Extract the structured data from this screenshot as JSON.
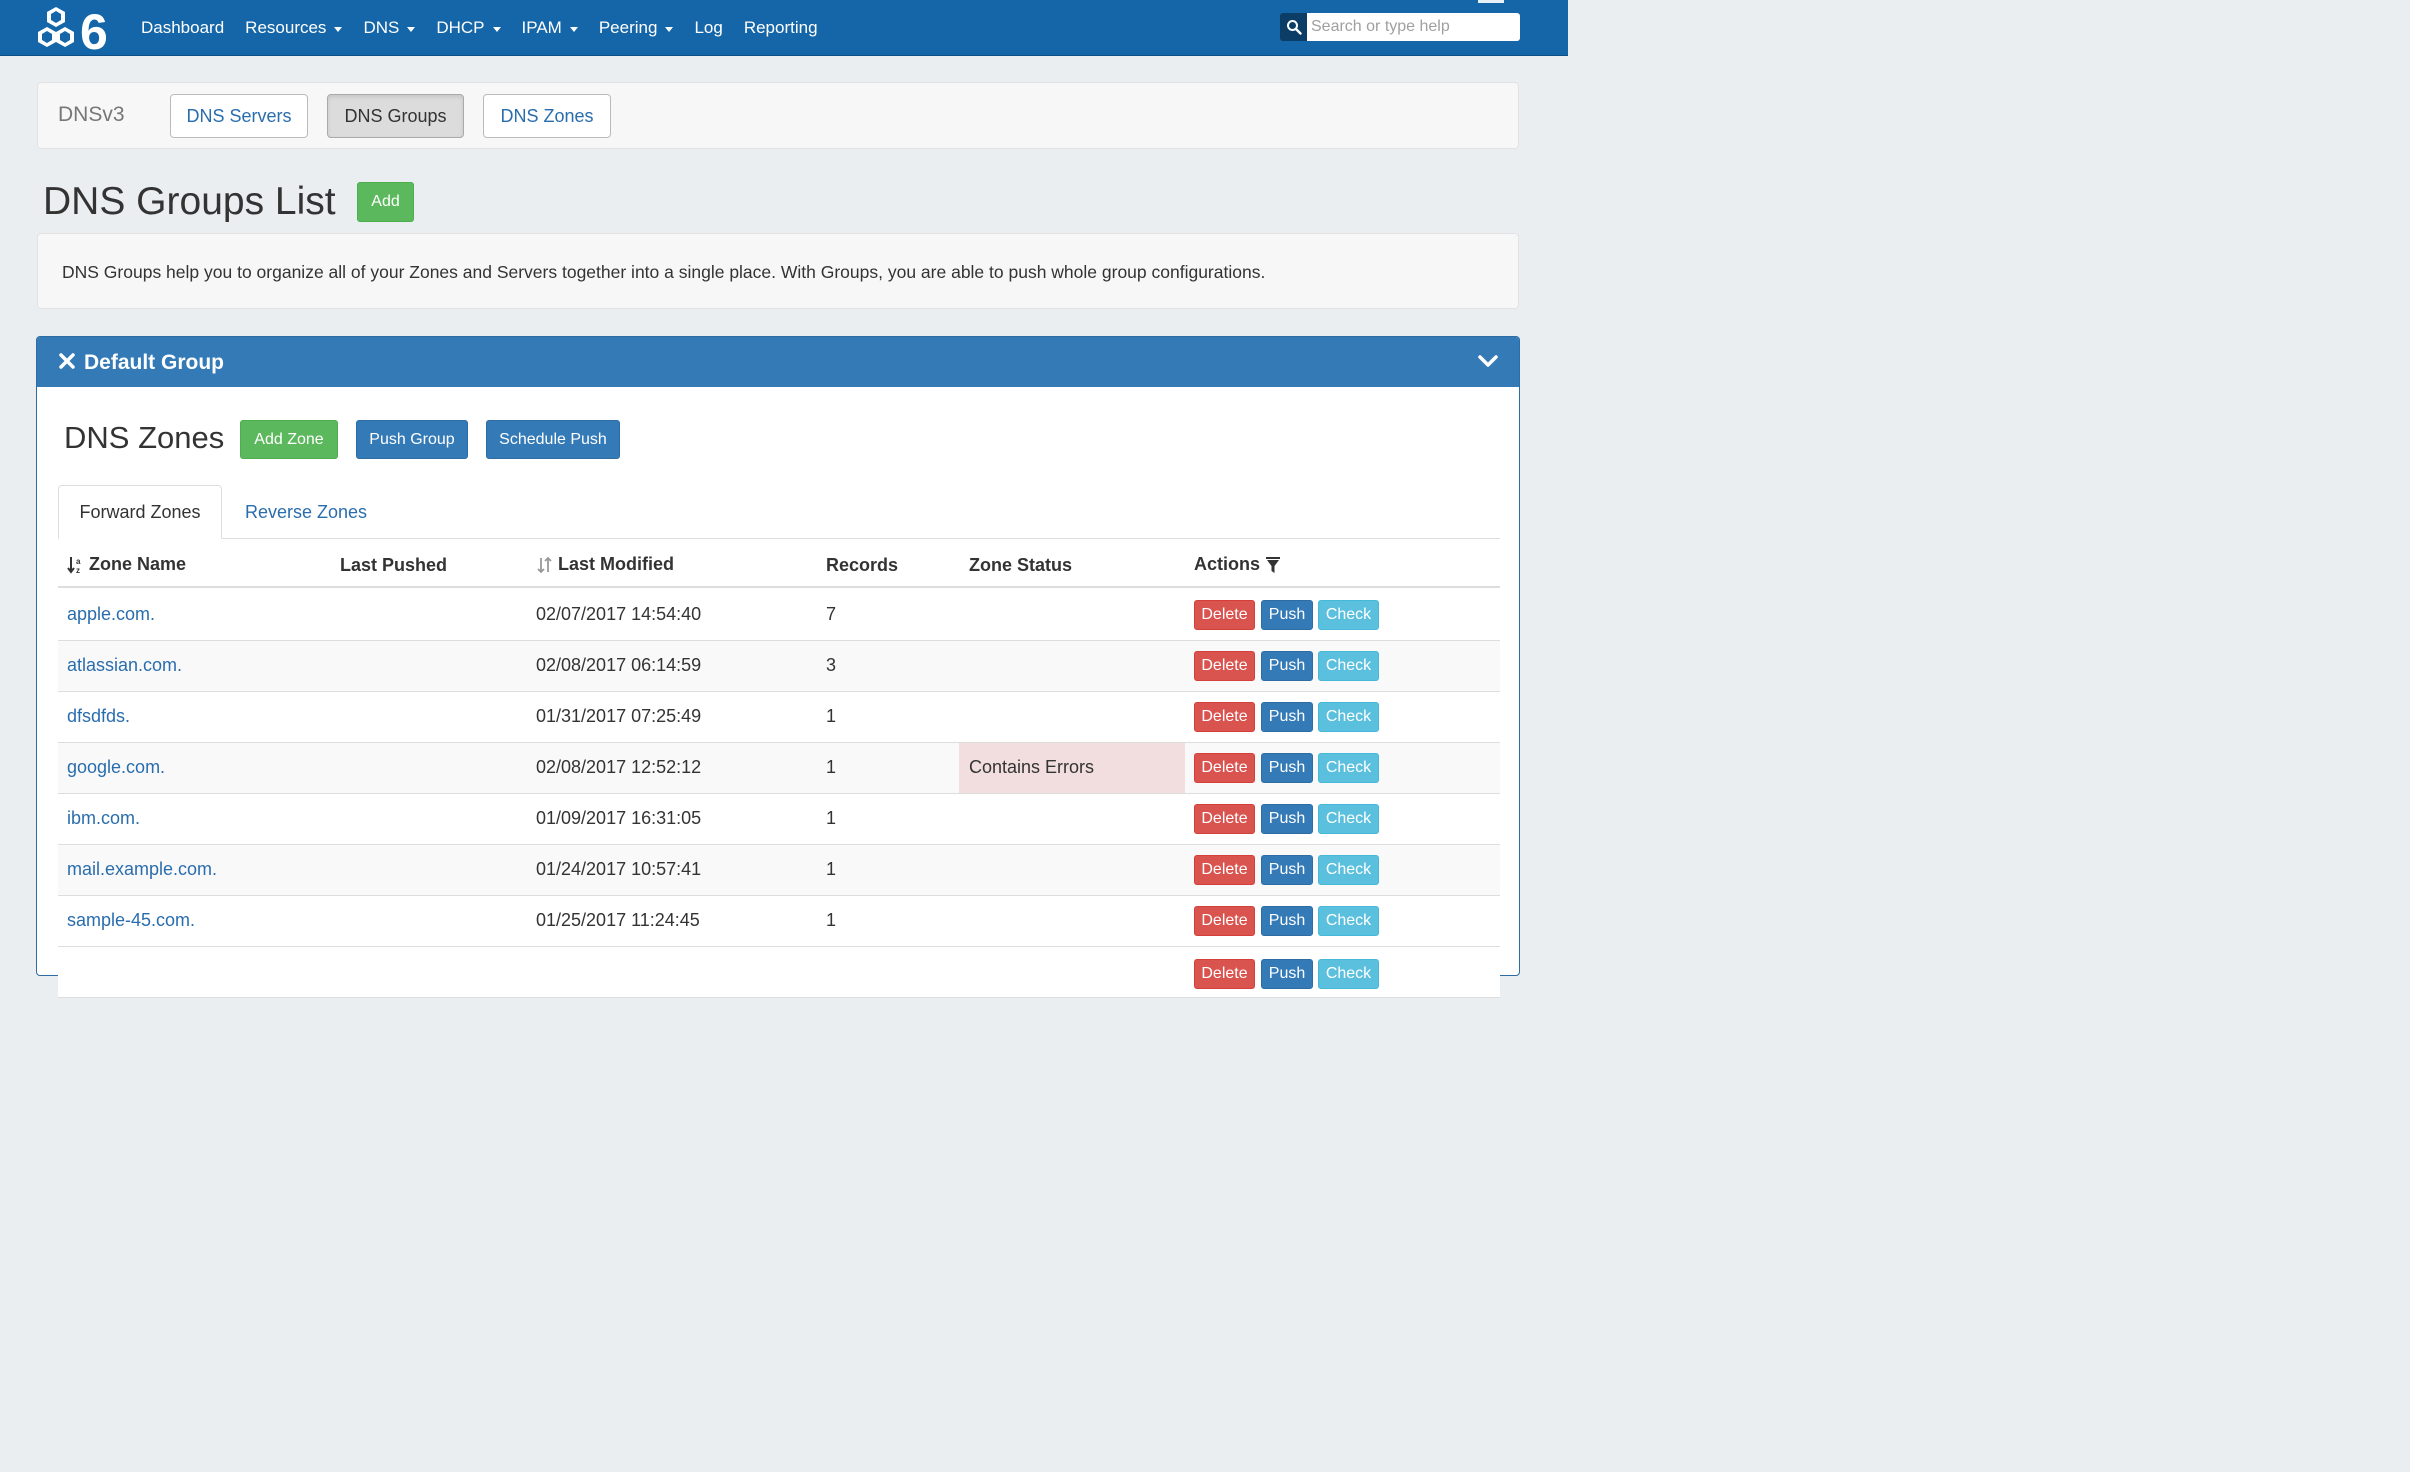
{
  "navbar": {
    "logo_text": "6",
    "items": [
      {
        "label": "Dashboard",
        "dropdown": false
      },
      {
        "label": "Resources",
        "dropdown": true
      },
      {
        "label": "DNS",
        "dropdown": true
      },
      {
        "label": "DHCP",
        "dropdown": true
      },
      {
        "label": "IPAM",
        "dropdown": true
      },
      {
        "label": "Peering",
        "dropdown": true
      },
      {
        "label": "Log",
        "dropdown": false
      },
      {
        "label": "Reporting",
        "dropdown": false
      }
    ],
    "search_placeholder": "Search or type help"
  },
  "subnav": {
    "title": "DNSv3",
    "buttons": [
      "DNS Servers",
      "DNS Groups",
      "DNS Zones"
    ],
    "active": "DNS Groups"
  },
  "page": {
    "title": "DNS Groups List",
    "add_label": "Add",
    "info": "DNS Groups help you to organize all of your Zones and Servers together into a single place. With Groups, you are able to push whole group configurations."
  },
  "group_panel": {
    "title": "Default Group",
    "zones_title": "DNS Zones",
    "add_zone_label": "Add Zone",
    "push_group_label": "Push Group",
    "schedule_push_label": "Schedule Push",
    "tabs": [
      "Forward Zones",
      "Reverse Zones"
    ],
    "active_tab": "Forward Zones",
    "columns": [
      "Zone Name",
      "Last Pushed",
      "Last Modified",
      "Records",
      "Zone Status",
      "Actions"
    ],
    "action_labels": {
      "delete": "Delete",
      "push": "Push",
      "check": "Check"
    },
    "rows": [
      {
        "zone": "apple.com.",
        "last_pushed": "",
        "last_modified": "02/07/2017 14:54:40",
        "records": "7",
        "status": ""
      },
      {
        "zone": "atlassian.com.",
        "last_pushed": "",
        "last_modified": "02/08/2017 06:14:59",
        "records": "3",
        "status": ""
      },
      {
        "zone": "dfsdfds.",
        "last_pushed": "",
        "last_modified": "01/31/2017 07:25:49",
        "records": "1",
        "status": ""
      },
      {
        "zone": "google.com.",
        "last_pushed": "",
        "last_modified": "02/08/2017 12:52:12",
        "records": "1",
        "status": "Contains Errors"
      },
      {
        "zone": "ibm.com.",
        "last_pushed": "",
        "last_modified": "01/09/2017 16:31:05",
        "records": "1",
        "status": ""
      },
      {
        "zone": "mail.example.com.",
        "last_pushed": "",
        "last_modified": "01/24/2017 10:57:41",
        "records": "1",
        "status": ""
      },
      {
        "zone": "sample-45.com.",
        "last_pushed": "",
        "last_modified": "01/25/2017 11:24:45",
        "records": "1",
        "status": ""
      }
    ]
  },
  "colors": {
    "navbar": "#1566a8",
    "primary": "#337ab7",
    "success": "#5cb85c",
    "danger": "#d9534f",
    "info": "#5bc0de",
    "error_cell": "#f2dede",
    "link": "#2a6dad"
  }
}
